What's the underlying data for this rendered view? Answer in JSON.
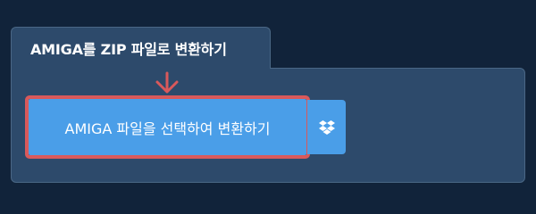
{
  "panel": {
    "title": "AMIGA를 ZIP 파일로 변환하기"
  },
  "actions": {
    "convert_label": "AMIGA 파일을 선택하여 변환하기",
    "dropbox_icon": "dropbox-icon"
  },
  "colors": {
    "background": "#11233a",
    "panel": "#2d4a6b",
    "button": "#4a9ee8",
    "highlight": "#d9595b"
  }
}
